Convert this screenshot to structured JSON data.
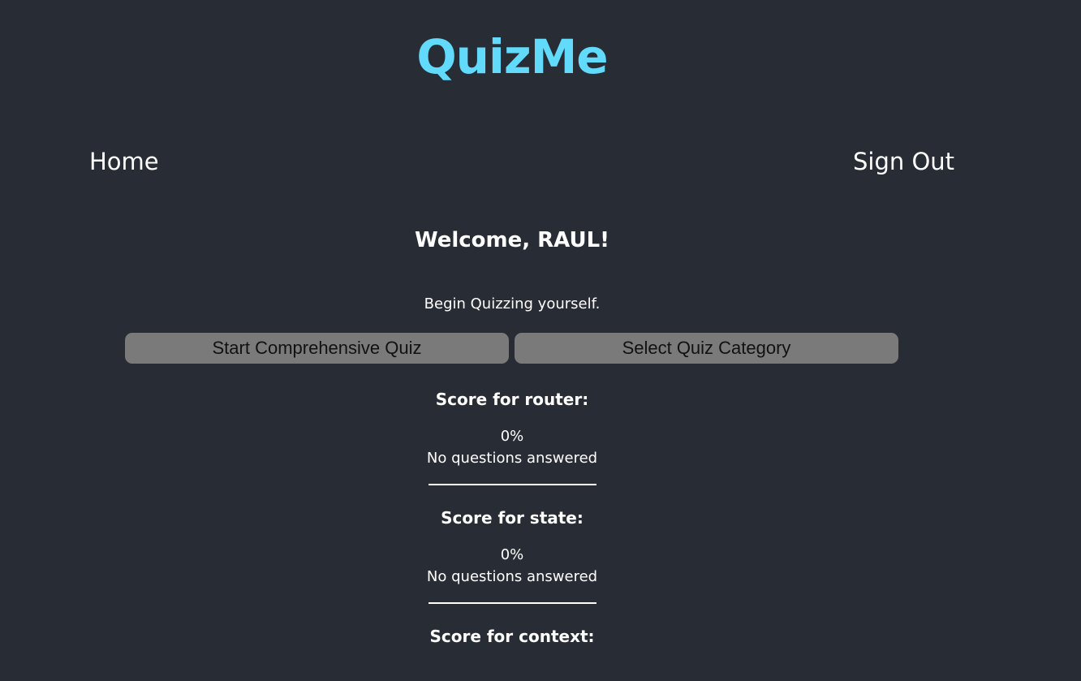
{
  "app": {
    "title": "QuizMe"
  },
  "nav": {
    "home": "Home",
    "sign_out": "Sign Out"
  },
  "main": {
    "welcome": "Welcome, RAUL!",
    "intro": "Begin Quizzing yourself.",
    "buttons": {
      "comprehensive": "Start Comprehensive Quiz",
      "category": "Select Quiz Category"
    }
  },
  "scores": [
    {
      "heading": "Score for router:",
      "value": "0%",
      "status": "No questions answered"
    },
    {
      "heading": "Score for state:",
      "value": "0%",
      "status": "No questions answered"
    },
    {
      "heading": "Score for context:"
    }
  ],
  "colors": {
    "background": "#282c34",
    "title": "#61dafb",
    "button": "#7a7a7a",
    "text": "#ffffff"
  }
}
